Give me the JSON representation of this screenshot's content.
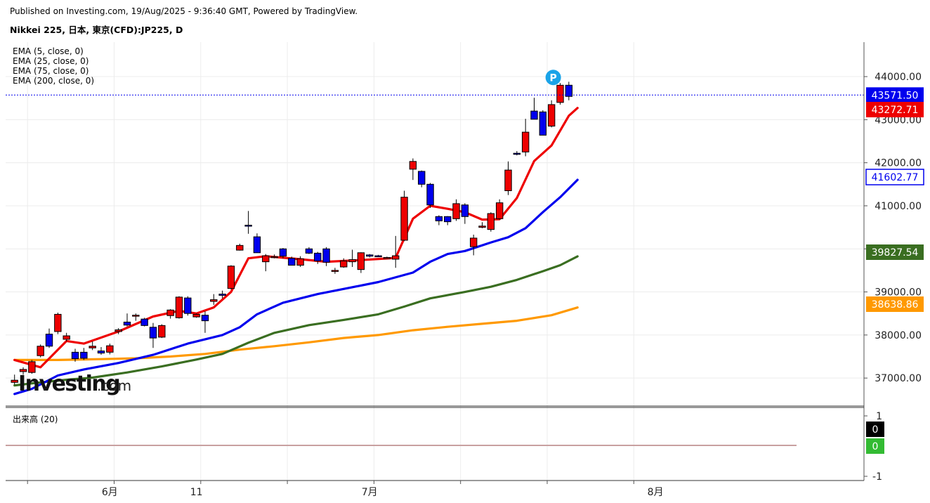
{
  "header": {
    "published": "Published on Investing.com, 19/Aug/2025 - 9:36:40 GMT, Powered by TradingView.",
    "symbol": "Nikkei 225, 日本, 東京(CFD):JP225, D"
  },
  "watermark": {
    "brand": "Investing",
    "suffix": ".com"
  },
  "chart_data": {
    "type": "candlestick",
    "ylim": [
      36350,
      44800
    ],
    "y_ticks": [
      "37000.00",
      "38000.00",
      "39000.00",
      "40000.00",
      "41000.00",
      "42000.00",
      "43000.00",
      "44000.00"
    ],
    "y_tick_values": [
      37000,
      38000,
      39000,
      40000,
      41000,
      42000,
      43000,
      44000
    ],
    "x_labels": [
      {
        "label": "6月",
        "index": 11
      },
      {
        "label": "11",
        "index": 21
      },
      {
        "label": "7月",
        "index": 41
      },
      {
        "label": "8月",
        "index": 74
      }
    ],
    "candles": [
      [
        36900,
        37080,
        36850,
        36950
      ],
      [
        37150,
        37250,
        37080,
        37200
      ],
      [
        37130,
        37420,
        37100,
        37380
      ],
      [
        37520,
        37780,
        37480,
        37740
      ],
      [
        38020,
        38150,
        37700,
        37740
      ],
      [
        38080,
        38520,
        38020,
        38480
      ],
      [
        37900,
        38050,
        37850,
        37980
      ],
      [
        37600,
        37680,
        37380,
        37450
      ],
      [
        37600,
        37700,
        37420,
        37460
      ],
      [
        37700,
        37850,
        37650,
        37740
      ],
      [
        37630,
        37720,
        37540,
        37580
      ],
      [
        37600,
        37800,
        37550,
        37750
      ],
      [
        38080,
        38160,
        38020,
        38120
      ],
      [
        38300,
        38500,
        38200,
        38230
      ],
      [
        38450,
        38500,
        38330,
        38460
      ],
      [
        38370,
        38400,
        38200,
        38220
      ],
      [
        38180,
        38280,
        37700,
        37930
      ],
      [
        37950,
        38250,
        37930,
        38220
      ],
      [
        38450,
        38600,
        38380,
        38580
      ],
      [
        38400,
        38900,
        38380,
        38880
      ],
      [
        38860,
        38900,
        38450,
        38500
      ],
      [
        38420,
        38500,
        38400,
        38480
      ],
      [
        38460,
        38550,
        38050,
        38330
      ],
      [
        38780,
        38950,
        38700,
        38820
      ],
      [
        38950,
        39030,
        38850,
        38920
      ],
      [
        39080,
        39620,
        39060,
        39600
      ],
      [
        39970,
        40120,
        39960,
        40080
      ],
      [
        40550,
        40880,
        40350,
        40530
      ],
      [
        40280,
        40360,
        39980,
        39910
      ],
      [
        39700,
        39880,
        39480,
        39840
      ],
      [
        39820,
        39870,
        39780,
        39820
      ],
      [
        40000,
        40020,
        39780,
        39830
      ],
      [
        39780,
        39820,
        39620,
        39620
      ],
      [
        39620,
        39830,
        39580,
        39770
      ],
      [
        40000,
        40040,
        39880,
        39900
      ],
      [
        39900,
        39930,
        39650,
        39720
      ],
      [
        40000,
        40040,
        39600,
        39690
      ],
      [
        39480,
        39560,
        39420,
        39500
      ],
      [
        39580,
        39780,
        39560,
        39720
      ],
      [
        39700,
        39980,
        39580,
        39750
      ],
      [
        39520,
        39920,
        39440,
        39910
      ],
      [
        39860,
        39880,
        39800,
        39830
      ],
      [
        39840,
        39860,
        39810,
        39830
      ],
      [
        39780,
        39820,
        39770,
        39800
      ],
      [
        39760,
        40300,
        39560,
        39840
      ],
      [
        40200,
        41350,
        40180,
        41200
      ],
      [
        41850,
        42100,
        41600,
        42030
      ],
      [
        41800,
        41820,
        41430,
        41500
      ],
      [
        41500,
        41530,
        40950,
        41020
      ],
      [
        40750,
        40780,
        40550,
        40650
      ],
      [
        40750,
        40760,
        40550,
        40630
      ],
      [
        40700,
        41150,
        40650,
        41050
      ],
      [
        41020,
        41060,
        40580,
        40750
      ],
      [
        40050,
        40330,
        39850,
        40250
      ],
      [
        40500,
        40620,
        40480,
        40530
      ],
      [
        40450,
        40850,
        40400,
        40820
      ],
      [
        40700,
        41150,
        40680,
        41070
      ],
      [
        41350,
        42030,
        41250,
        41830
      ],
      [
        42220,
        42270,
        42170,
        42210
      ],
      [
        42250,
        43020,
        42150,
        42710
      ],
      [
        43200,
        43510,
        43050,
        43010
      ],
      [
        43180,
        43220,
        42640,
        42640
      ],
      [
        42850,
        43450,
        42820,
        43350
      ],
      [
        43400,
        43850,
        43350,
        43800
      ],
      [
        43800,
        43880,
        43450,
        43540
      ]
    ],
    "ema_series": [
      {
        "name": "EMA (5, close, 0)",
        "color": "#ee0000",
        "last": "43272.71"
      },
      {
        "name": "EMA (25, close, 0)",
        "color": "#0000ee",
        "last": "41602.77"
      },
      {
        "name": "EMA (75, close, 0)",
        "color": "#3a6e21",
        "last": "39827.54"
      },
      {
        "name": "EMA (200, close, 0)",
        "color": "#ff9900",
        "last": "38638.86"
      }
    ],
    "ema_keypoints": {
      "ema5": [
        [
          0,
          37420
        ],
        [
          3,
          37250
        ],
        [
          6,
          37860
        ],
        [
          8,
          37800
        ],
        [
          12,
          38080
        ],
        [
          16,
          38430
        ],
        [
          19,
          38560
        ],
        [
          21,
          38500
        ],
        [
          23,
          38640
        ],
        [
          25,
          39000
        ],
        [
          27,
          39780
        ],
        [
          29,
          39830
        ],
        [
          33,
          39760
        ],
        [
          36,
          39700
        ],
        [
          40,
          39740
        ],
        [
          44,
          39790
        ],
        [
          46,
          40700
        ],
        [
          48,
          41000
        ],
        [
          50,
          40930
        ],
        [
          52,
          40850
        ],
        [
          54,
          40680
        ],
        [
          56,
          40690
        ],
        [
          58,
          41180
        ],
        [
          60,
          42040
        ],
        [
          62,
          42400
        ],
        [
          64,
          43090
        ],
        [
          65,
          43272
        ]
      ],
      "ema25": [
        [
          0,
          36630
        ],
        [
          2,
          36750
        ],
        [
          5,
          37060
        ],
        [
          8,
          37200
        ],
        [
          12,
          37350
        ],
        [
          16,
          37540
        ],
        [
          20,
          37800
        ],
        [
          24,
          38000
        ],
        [
          26,
          38180
        ],
        [
          28,
          38480
        ],
        [
          31,
          38750
        ],
        [
          35,
          38950
        ],
        [
          38,
          39070
        ],
        [
          42,
          39230
        ],
        [
          46,
          39450
        ],
        [
          48,
          39700
        ],
        [
          50,
          39880
        ],
        [
          52,
          39950
        ],
        [
          55,
          40150
        ],
        [
          57,
          40270
        ],
        [
          59,
          40480
        ],
        [
          61,
          40850
        ],
        [
          63,
          41200
        ],
        [
          65,
          41602
        ]
      ],
      "ema75": [
        [
          0,
          36830
        ],
        [
          3,
          36900
        ],
        [
          6,
          36960
        ],
        [
          9,
          37010
        ],
        [
          13,
          37130
        ],
        [
          17,
          37270
        ],
        [
          21,
          37430
        ],
        [
          24,
          37560
        ],
        [
          27,
          37820
        ],
        [
          30,
          38050
        ],
        [
          34,
          38230
        ],
        [
          38,
          38350
        ],
        [
          42,
          38480
        ],
        [
          45,
          38660
        ],
        [
          48,
          38850
        ],
        [
          52,
          39000
        ],
        [
          55,
          39120
        ],
        [
          58,
          39280
        ],
        [
          61,
          39480
        ],
        [
          63,
          39620
        ],
        [
          65,
          39827
        ]
      ],
      "ema200": [
        [
          0,
          37420
        ],
        [
          5,
          37420
        ],
        [
          10,
          37440
        ],
        [
          14,
          37460
        ],
        [
          18,
          37500
        ],
        [
          22,
          37560
        ],
        [
          26,
          37660
        ],
        [
          30,
          37740
        ],
        [
          34,
          37830
        ],
        [
          38,
          37930
        ],
        [
          42,
          38000
        ],
        [
          46,
          38110
        ],
        [
          50,
          38190
        ],
        [
          54,
          38260
        ],
        [
          58,
          38330
        ],
        [
          62,
          38460
        ],
        [
          65,
          38638
        ]
      ]
    },
    "price_tags": [
      {
        "text": "43571.50",
        "value": 43571.5,
        "bg": "#0000ee",
        "fg": "#ffffff",
        "bordered": false
      },
      {
        "text": "43272.71",
        "value": 43272.71,
        "bg": "#ee0000",
        "fg": "#ffffff",
        "bordered": false
      },
      {
        "text": "41602.77",
        "value": 41602.77,
        "bg": "#ffffff",
        "fg": "#0000ee",
        "bordered": true
      },
      {
        "text": "39827.54",
        "value": 39827.54,
        "bg": "#3a6e21",
        "fg": "#ffffff",
        "bordered": false
      },
      {
        "text": "38638.86",
        "value": 38638.86,
        "bg": "#ff9900",
        "fg": "#ffffff",
        "bordered": false
      }
    ],
    "last_price": 43571.5,
    "volume": {
      "label": "出来高 (20)",
      "y_ticks": [
        "1",
        "-1"
      ],
      "tags": [
        {
          "text": "0",
          "bg": "#000000"
        },
        {
          "text": "0",
          "bg": "#33bb33"
        }
      ]
    },
    "grid": true,
    "marker_label": "P",
    "colors": {
      "up": "#ee0000",
      "down": "#0000ee",
      "outline": "#000000"
    }
  }
}
